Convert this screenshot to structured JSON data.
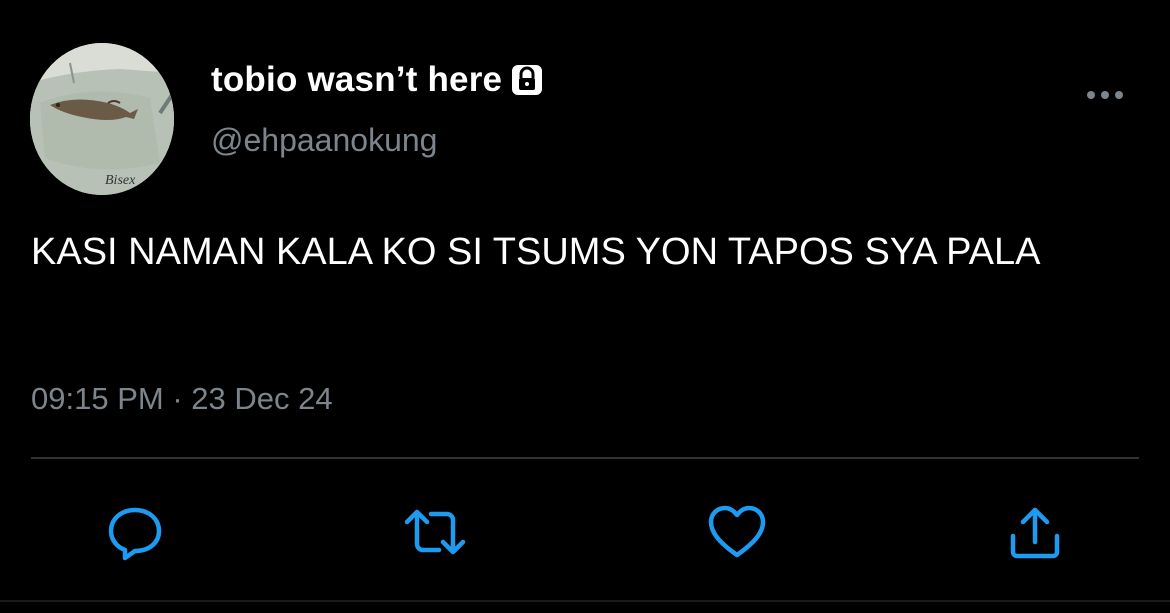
{
  "author": {
    "display_name": "tobio wasn’t here",
    "handle": "@ehpaanokung",
    "avatar_caption": "Bisex",
    "protected_icon": "lock-icon"
  },
  "tweet": {
    "text": "KASI NAMAN KALA KO SI TSUMS YON TAPOS SYA PALA",
    "time": "09:15 PM",
    "separator": "·",
    "date": "23 Dec 24"
  },
  "actions": [
    {
      "name": "reply",
      "icon": "speech-bubble-icon"
    },
    {
      "name": "retweet",
      "icon": "retweet-arrows-icon"
    },
    {
      "name": "like",
      "icon": "heart-icon"
    },
    {
      "name": "share",
      "icon": "upload-share-icon"
    }
  ],
  "colors": {
    "background": "#000000",
    "primary_text": "#ffffff",
    "secondary_text": "#7c848c",
    "action_icon": "#1d9bf0",
    "divider": "#2f3336"
  }
}
